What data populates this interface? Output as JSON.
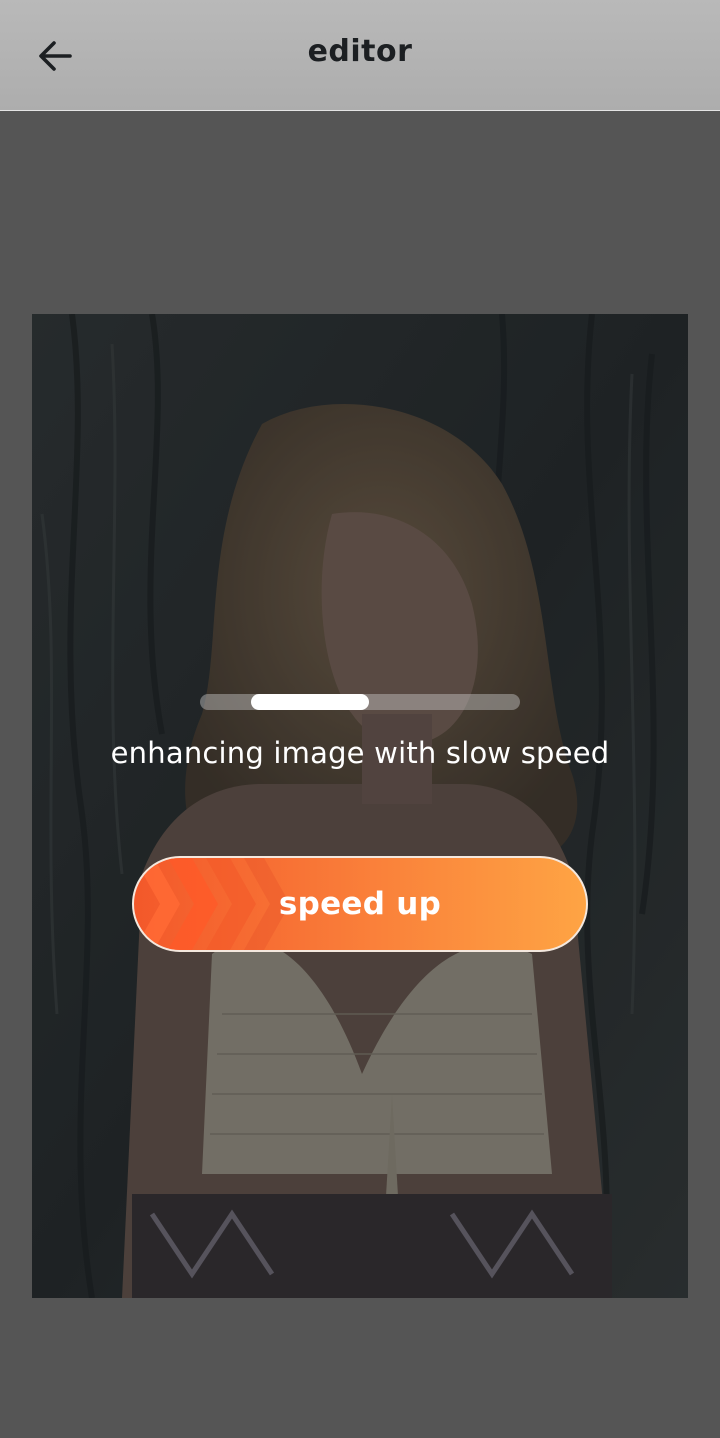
{
  "header": {
    "title": "editor",
    "back_icon": "arrow-left-icon"
  },
  "enhance": {
    "progress": 0.37,
    "status_text": "enhancing image with slow speed",
    "speed_up_label": "speed up"
  },
  "colors": {
    "button_start": "#f3582a",
    "button_end": "#fea444",
    "overlay": "#555555"
  }
}
